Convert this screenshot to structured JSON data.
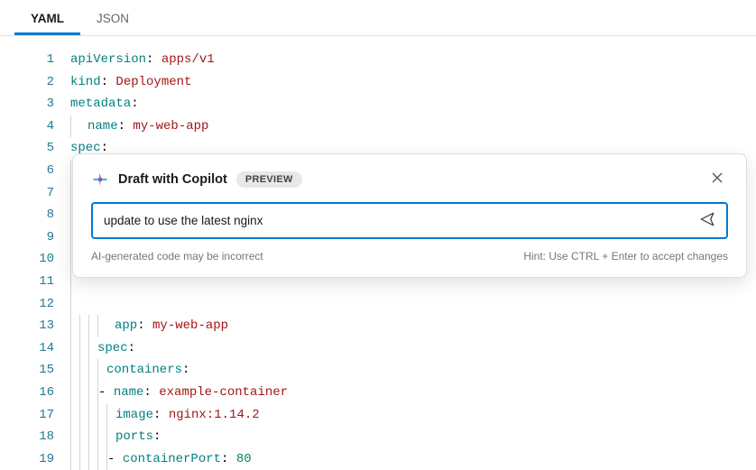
{
  "tabs": [
    {
      "label": "YAML",
      "active": true
    },
    {
      "label": "JSON",
      "active": false
    }
  ],
  "lineNumbers": [
    "1",
    "2",
    "3",
    "4",
    "5",
    "6",
    "7",
    "8",
    "9",
    "10",
    "11",
    "12",
    "13",
    "14",
    "15",
    "16",
    "17",
    "18",
    "19"
  ],
  "code": {
    "l1_k": "apiVersion",
    "l1_v": "apps/v1",
    "l2_k": "kind",
    "l2_v": "Deployment",
    "l3_k": "metadata",
    "l4_k": "name",
    "l4_v": "my-web-app",
    "l5_k": "spec",
    "l13_k": "app",
    "l13_v": "my-web-app",
    "l14_k": "spec",
    "l15_k": "containers",
    "l16_k": "name",
    "l16_v": "example-container",
    "l17_k": "image",
    "l17_v": "nginx:1.14.2",
    "l18_k": "ports",
    "l19_k": "containerPort",
    "l19_v": "80"
  },
  "copilot": {
    "title": "Draft with Copilot",
    "badge": "PREVIEW",
    "prompt": "update to use the latest nginx",
    "disclaimer": "AI-generated code may be incorrect",
    "hint": "Hint: Use CTRL + Enter to accept changes"
  }
}
